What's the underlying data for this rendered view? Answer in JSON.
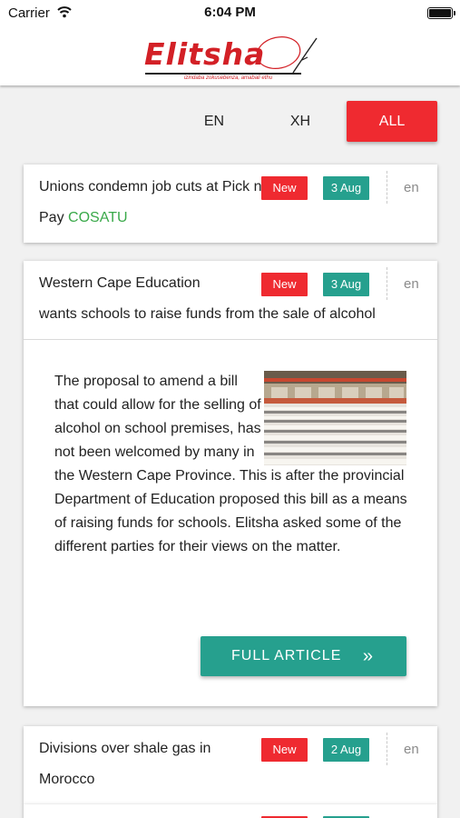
{
  "status_bar": {
    "carrier": "Carrier",
    "time": "6:04 PM"
  },
  "app": {
    "logo_text": "Elitsha",
    "logo_tagline": "izindaba zokusebenza, amabali ethu",
    "brand_color": "#d32026"
  },
  "filters": {
    "tabs": [
      {
        "label": "EN",
        "selected": false
      },
      {
        "label": "XH",
        "selected": false
      },
      {
        "label": "ALL",
        "selected": true
      }
    ]
  },
  "articles": [
    {
      "title": "Unions condemn job cuts at Pick n Pay",
      "title_tag": "COSATU",
      "new_label": "New",
      "date": "3 Aug",
      "lang": "en",
      "expanded": false
    },
    {
      "title_line1": "Western Cape Education",
      "title_line2": "wants schools to raise funds from the sale of alcohol",
      "new_label": "New",
      "date": "3 Aug",
      "lang": "en",
      "expanded": true,
      "summary": "The proposal to amend a bill that could allow for the selling of alcohol on school premises, has not been welcomed by many in the Western Cape Province. This is after the provincial Department of Education proposed this bill as a means of raising funds for schools. Elitsha asked some of the different parties for their views on the matter.",
      "button_label": "FULL ARTICLE",
      "button_icon": "double-chevron-right-icon"
    },
    {
      "title": "Divisions over shale gas in Morocco",
      "new_label": "New",
      "date": "2 Aug",
      "lang": "en",
      "expanded": false
    }
  ],
  "colors": {
    "accent_red": "#ef2a30",
    "accent_teal": "#26a08e",
    "tag_green": "#3aa94a"
  }
}
